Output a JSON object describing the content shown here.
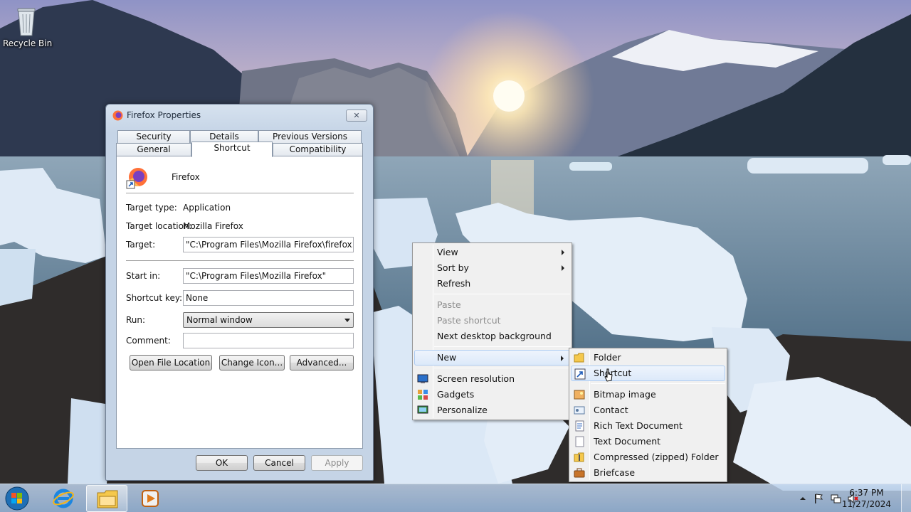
{
  "desktop": {
    "icons": [
      {
        "label": "Recycle Bin",
        "icon": "recycle-bin-icon"
      }
    ]
  },
  "properties_window": {
    "title": "Firefox Properties",
    "close_label": "✕",
    "tabs_top": [
      "Security",
      "Details",
      "Previous Versions"
    ],
    "tabs_bottom": [
      "General",
      "Shortcut",
      "Compatibility"
    ],
    "active_tab": "Shortcut",
    "app_name": "Firefox",
    "target_type_label": "Target type:",
    "target_type_value": "Application",
    "target_location_label": "Target location:",
    "target_location_value": "Mozilla Firefox",
    "target_label": "Target:",
    "target_value": "\"C:\\Program Files\\Mozilla Firefox\\firefox.exe\"",
    "start_in_label": "Start in:",
    "start_in_value": "\"C:\\Program Files\\Mozilla Firefox\"",
    "shortcut_key_label": "Shortcut key:",
    "shortcut_key_value": "None",
    "run_label": "Run:",
    "run_value": "Normal window",
    "comment_label": "Comment:",
    "comment_value": "",
    "buttons": {
      "open_file_location": "Open File Location",
      "change_icon": "Change Icon...",
      "advanced": "Advanced..."
    },
    "footer": {
      "ok": "OK",
      "cancel": "Cancel",
      "apply": "Apply"
    }
  },
  "context_menu": {
    "items": {
      "view": "View",
      "sort_by": "Sort by",
      "refresh": "Refresh",
      "paste": "Paste",
      "paste_shortcut": "Paste shortcut",
      "next_bg": "Next desktop background",
      "new": "New",
      "screen_resolution": "Screen resolution",
      "gadgets": "Gadgets",
      "personalize": "Personalize"
    }
  },
  "new_submenu": {
    "items": {
      "folder": "Folder",
      "shortcut": "Shortcut",
      "bitmap": "Bitmap image",
      "contact": "Contact",
      "rtf": "Rich Text Document",
      "txt": "Text Document",
      "zip": "Compressed (zipped) Folder",
      "briefcase": "Briefcase"
    }
  },
  "taskbar": {
    "pinned": [
      "start-orb",
      "internet-explorer-icon",
      "file-explorer-icon",
      "media-player-icon"
    ],
    "clock_time": "6:37 PM",
    "clock_date": "11/27/2024"
  }
}
